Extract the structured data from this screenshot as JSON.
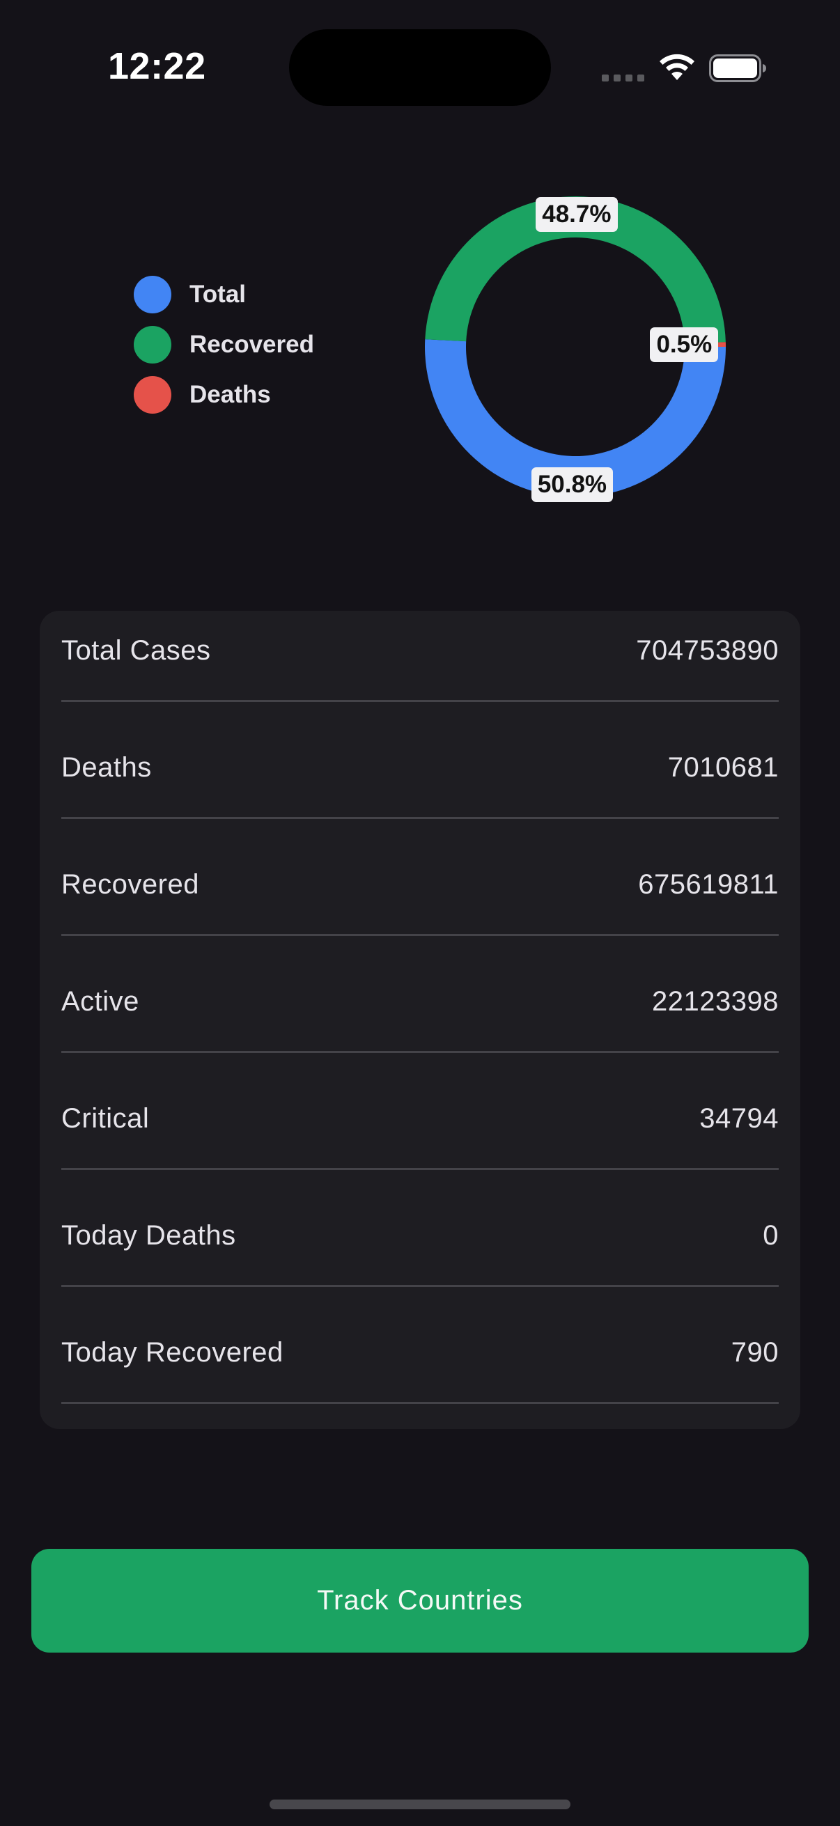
{
  "status_bar": {
    "time": "12:22"
  },
  "chart_data": {
    "type": "pie",
    "style": "donut",
    "legend_position": "left",
    "legend": [
      {
        "label": "Total",
        "color": "#4285f4"
      },
      {
        "label": "Recovered",
        "color": "#1ba362"
      },
      {
        "label": "Deaths",
        "color": "#e5524a"
      }
    ],
    "slices": [
      {
        "label": "Total",
        "value": 50.8,
        "display": "50.8%",
        "color": "#4285f4"
      },
      {
        "label": "Recovered",
        "value": 48.7,
        "display": "48.7%",
        "color": "#1ba362"
      },
      {
        "label": "Deaths",
        "value": 0.5,
        "display": "0.5%",
        "color": "#e5524a"
      }
    ]
  },
  "stats": [
    {
      "label": "Total Cases",
      "value": "704753890"
    },
    {
      "label": "Deaths",
      "value": "7010681"
    },
    {
      "label": "Recovered",
      "value": "675619811"
    },
    {
      "label": "Active",
      "value": "22123398"
    },
    {
      "label": "Critical",
      "value": "34794"
    },
    {
      "label": "Today Deaths",
      "value": "0"
    },
    {
      "label": "Today Recovered",
      "value": "790"
    }
  ],
  "button": {
    "label": "Track Countries",
    "color": "#1ba362"
  }
}
